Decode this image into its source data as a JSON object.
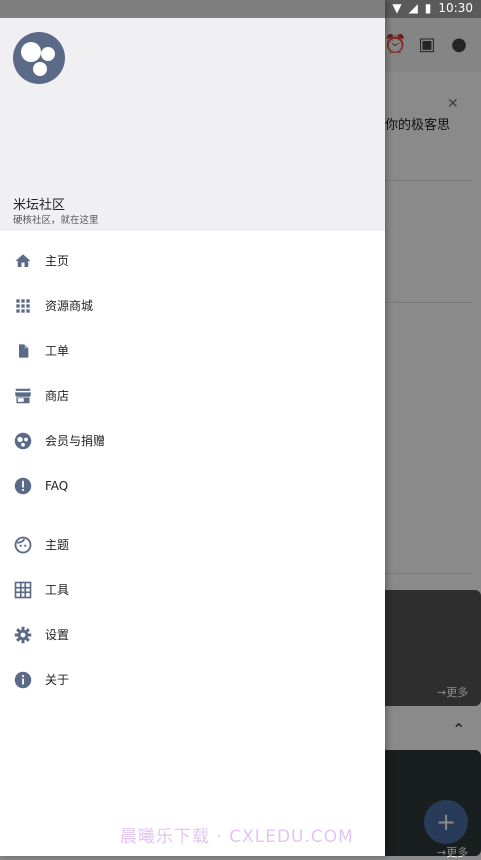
{
  "status_bar": {
    "time": "10:30"
  },
  "background": {
    "card_text": "你的极客思",
    "more_label": "→更多",
    "more_label_2": "→更多"
  },
  "drawer": {
    "title": "米坛社区",
    "subtitle": "硬核社区，就在这里",
    "menu": [
      {
        "label": "主页",
        "icon": "home-icon"
      },
      {
        "label": "资源商城",
        "icon": "apps-grid-icon"
      },
      {
        "label": "工单",
        "icon": "document-icon"
      },
      {
        "label": "商店",
        "icon": "store-icon"
      },
      {
        "label": "会员与捐赠",
        "icon": "membership-icon"
      },
      {
        "label": "FAQ",
        "icon": "alert-circle-icon"
      },
      {
        "label": "主题",
        "icon": "face-icon"
      },
      {
        "label": "工具",
        "icon": "grid-icon"
      },
      {
        "label": "设置",
        "icon": "settings-icon"
      },
      {
        "label": "关于",
        "icon": "info-icon"
      }
    ]
  },
  "watermark": "晨曦乐下载 · CXLEDU.COM",
  "colors": {
    "icon": "#5b6b87",
    "header_bg": "#f0f0f3",
    "fab": "#4a6fa5"
  }
}
